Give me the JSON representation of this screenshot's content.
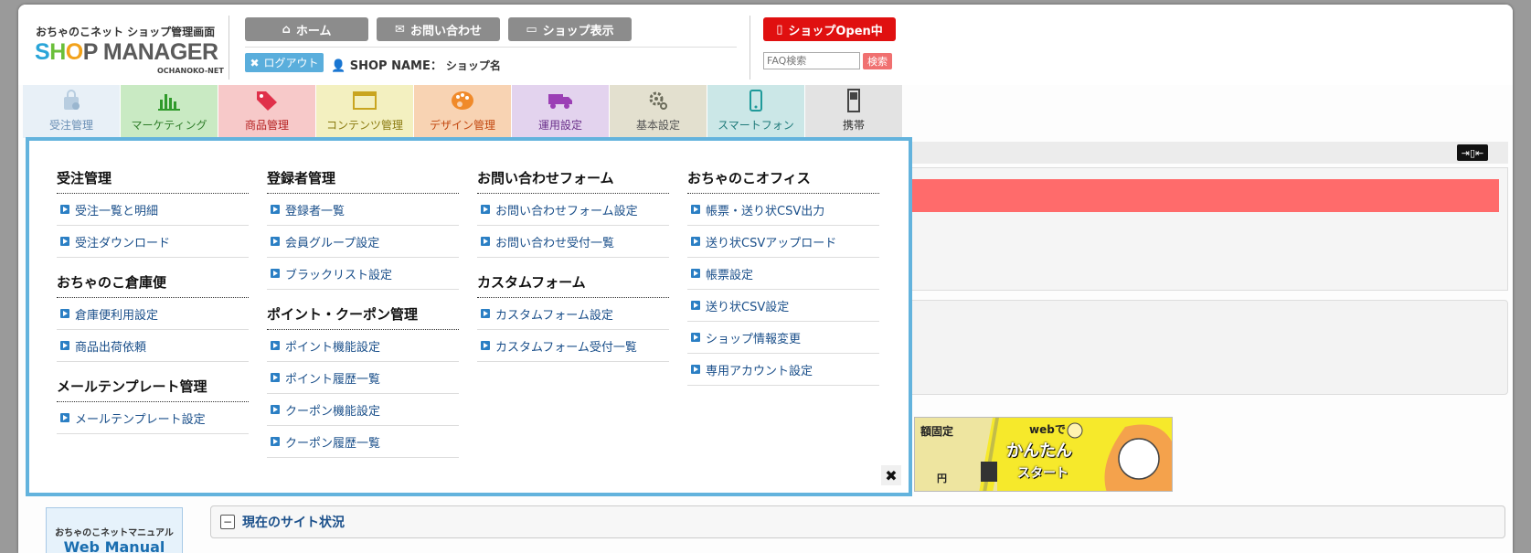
{
  "header": {
    "logo_sub": "おちゃのこネット ショップ管理画面",
    "logo_parts": [
      "S",
      "H",
      "O",
      "P MANAGER"
    ],
    "logo_en": "OCHANOKO-NET",
    "nav": {
      "home": "ホーム",
      "contact": "お問い合わせ",
      "shop_view": "ショップ表示"
    },
    "logout": "ログアウト",
    "shopname_label": "SHOP NAME：",
    "shopname_value": "ショップ名",
    "open_status": "ショップOpen中",
    "faq_placeholder": "FAQ検索",
    "faq_button": "検索"
  },
  "tabs": [
    {
      "label": "受注管理",
      "bg": "#e8f0f7",
      "color": "#6a8fb5",
      "icon": "shopping-bag-icon"
    },
    {
      "label": "マーケティング",
      "bg": "#c9eac3",
      "color": "#2f7d2a",
      "icon": "bar-chart-icon"
    },
    {
      "label": "商品管理",
      "bg": "#f7c9c9",
      "color": "#b52222",
      "icon": "price-tag-icon"
    },
    {
      "label": "コンテンツ管理",
      "bg": "#f3f0c0",
      "color": "#8a7a10",
      "icon": "window-icon"
    },
    {
      "label": "デザイン管理",
      "bg": "#f8d3b3",
      "color": "#c2470f",
      "icon": "palette-icon"
    },
    {
      "label": "運用設定",
      "bg": "#e3d3ee",
      "color": "#6a2f8a",
      "icon": "truck-icon"
    },
    {
      "label": "基本設定",
      "bg": "#e3e0cf",
      "color": "#555",
      "icon": "gear-icon"
    },
    {
      "label": "スマートフォン",
      "bg": "#cbe7e7",
      "color": "#1f7a7a",
      "icon": "smartphone-icon"
    },
    {
      "label": "携帯",
      "bg": "#e3e3e3",
      "color": "#333",
      "icon": "mobile-phone-icon"
    }
  ],
  "megamenu": {
    "columns": [
      [
        {
          "title": "受注管理",
          "items": [
            "受注一覧と明細",
            "受注ダウンロード"
          ]
        },
        {
          "title": "おちゃのこ倉庫便",
          "items": [
            "倉庫便利用設定",
            "商品出荷依頼"
          ]
        },
        {
          "title": "メールテンプレート管理",
          "items": [
            "メールテンプレート設定"
          ]
        }
      ],
      [
        {
          "title": "登録者管理",
          "items": [
            "登録者一覧",
            "会員グループ設定",
            "ブラックリスト設定"
          ]
        },
        {
          "title": "ポイント・クーポン管理",
          "items": [
            "ポイント機能設定",
            "ポイント履歴一覧",
            "クーポン機能設定",
            "クーポン履歴一覧"
          ]
        }
      ],
      [
        {
          "title": "お問い合わせフォーム",
          "items": [
            "お問い合わせフォーム設定",
            "お問い合わせ受付一覧"
          ]
        },
        {
          "title": "カスタムフォーム",
          "items": [
            "カスタムフォーム設定",
            "カスタムフォーム受付一覧"
          ]
        }
      ],
      [
        {
          "title": "おちゃのこオフィス",
          "items": [
            "帳票・送り状CSV出力",
            "送り状CSVアップロード",
            "帳票設定",
            "送り状CSV設定",
            "ショップ情報変更",
            "専用アカウント設定"
          ]
        }
      ]
    ],
    "close_glyph": "✖"
  },
  "background": {
    "status_title": "現在のサイト状況",
    "manual_line1": "おちゃのこネットマニュアル",
    "manual_line2": "Web Manual",
    "banner": {
      "text1": "額固定",
      "text2": "webで",
      "text3": "かんたん",
      "text4": "スタート",
      "text5": "円"
    }
  }
}
